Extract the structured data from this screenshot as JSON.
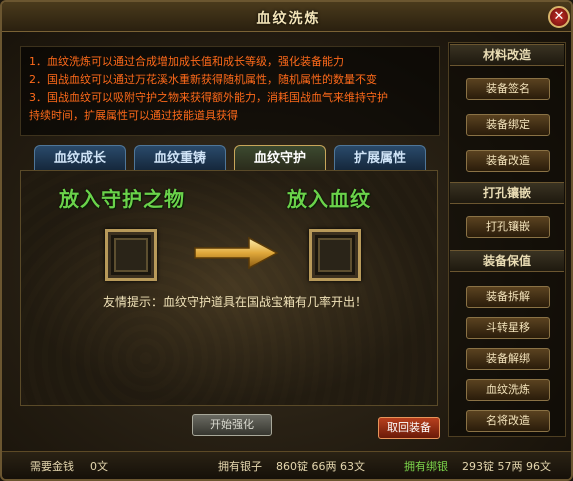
{
  "window": {
    "title": "血纹洗炼",
    "close_glyph": "✕"
  },
  "description": {
    "lines": [
      "1．血纹洗炼可以通过合成增加成长值和成长等级，强化装备能力",
      "2．国战血纹可以通过万花溪水重新获得随机属性，随机属性的数量不变",
      "3．国战血纹可以吸附守护之物来获得额外能力，消耗国战血气来维持守护",
      "持续时间，扩展属性可以通过技能道具获得"
    ]
  },
  "tabs": [
    {
      "label": "血纹成长"
    },
    {
      "label": "血纹重铸"
    },
    {
      "label": "血纹守护"
    },
    {
      "label": "扩展属性"
    }
  ],
  "active_tab": "血纹守护",
  "panel": {
    "left_slot_title": "放入守护之物",
    "right_slot_title": "放入血纹",
    "tip": "友情提示：血纹守护道具在国战宝箱有几率开出！"
  },
  "actions": {
    "start_label": "开始强化",
    "retrieve_label": "取回装备"
  },
  "sidebar": {
    "sections": [
      {
        "header": "材料改造",
        "items": [
          "装备签名",
          "装备绑定",
          "装备改造"
        ]
      },
      {
        "header": "打孔镶嵌",
        "items": [
          "打孔镶嵌"
        ]
      },
      {
        "header": "装备保值",
        "items": [
          "装备拆解",
          "斗转星移",
          "装备解绑",
          "血纹洗炼",
          "名将改造"
        ]
      }
    ]
  },
  "footer": {
    "cost_label": "需要金钱",
    "cost_value": "0文",
    "silver_label": "拥有银子",
    "silver_value": "860锭 66两 63文",
    "bound_label": "拥有绑银",
    "bound_value": "293锭 57两 96文"
  },
  "colors": {
    "description_text": "#ff6a1a",
    "slot_title": "#6ad24a",
    "bound_label": "#7ad44a",
    "tab_inactive": "#2a4a6a",
    "retrieve_button": "#b8401e"
  },
  "icons": {
    "close": "close-icon",
    "arrow": "arrow-right-icon"
  }
}
